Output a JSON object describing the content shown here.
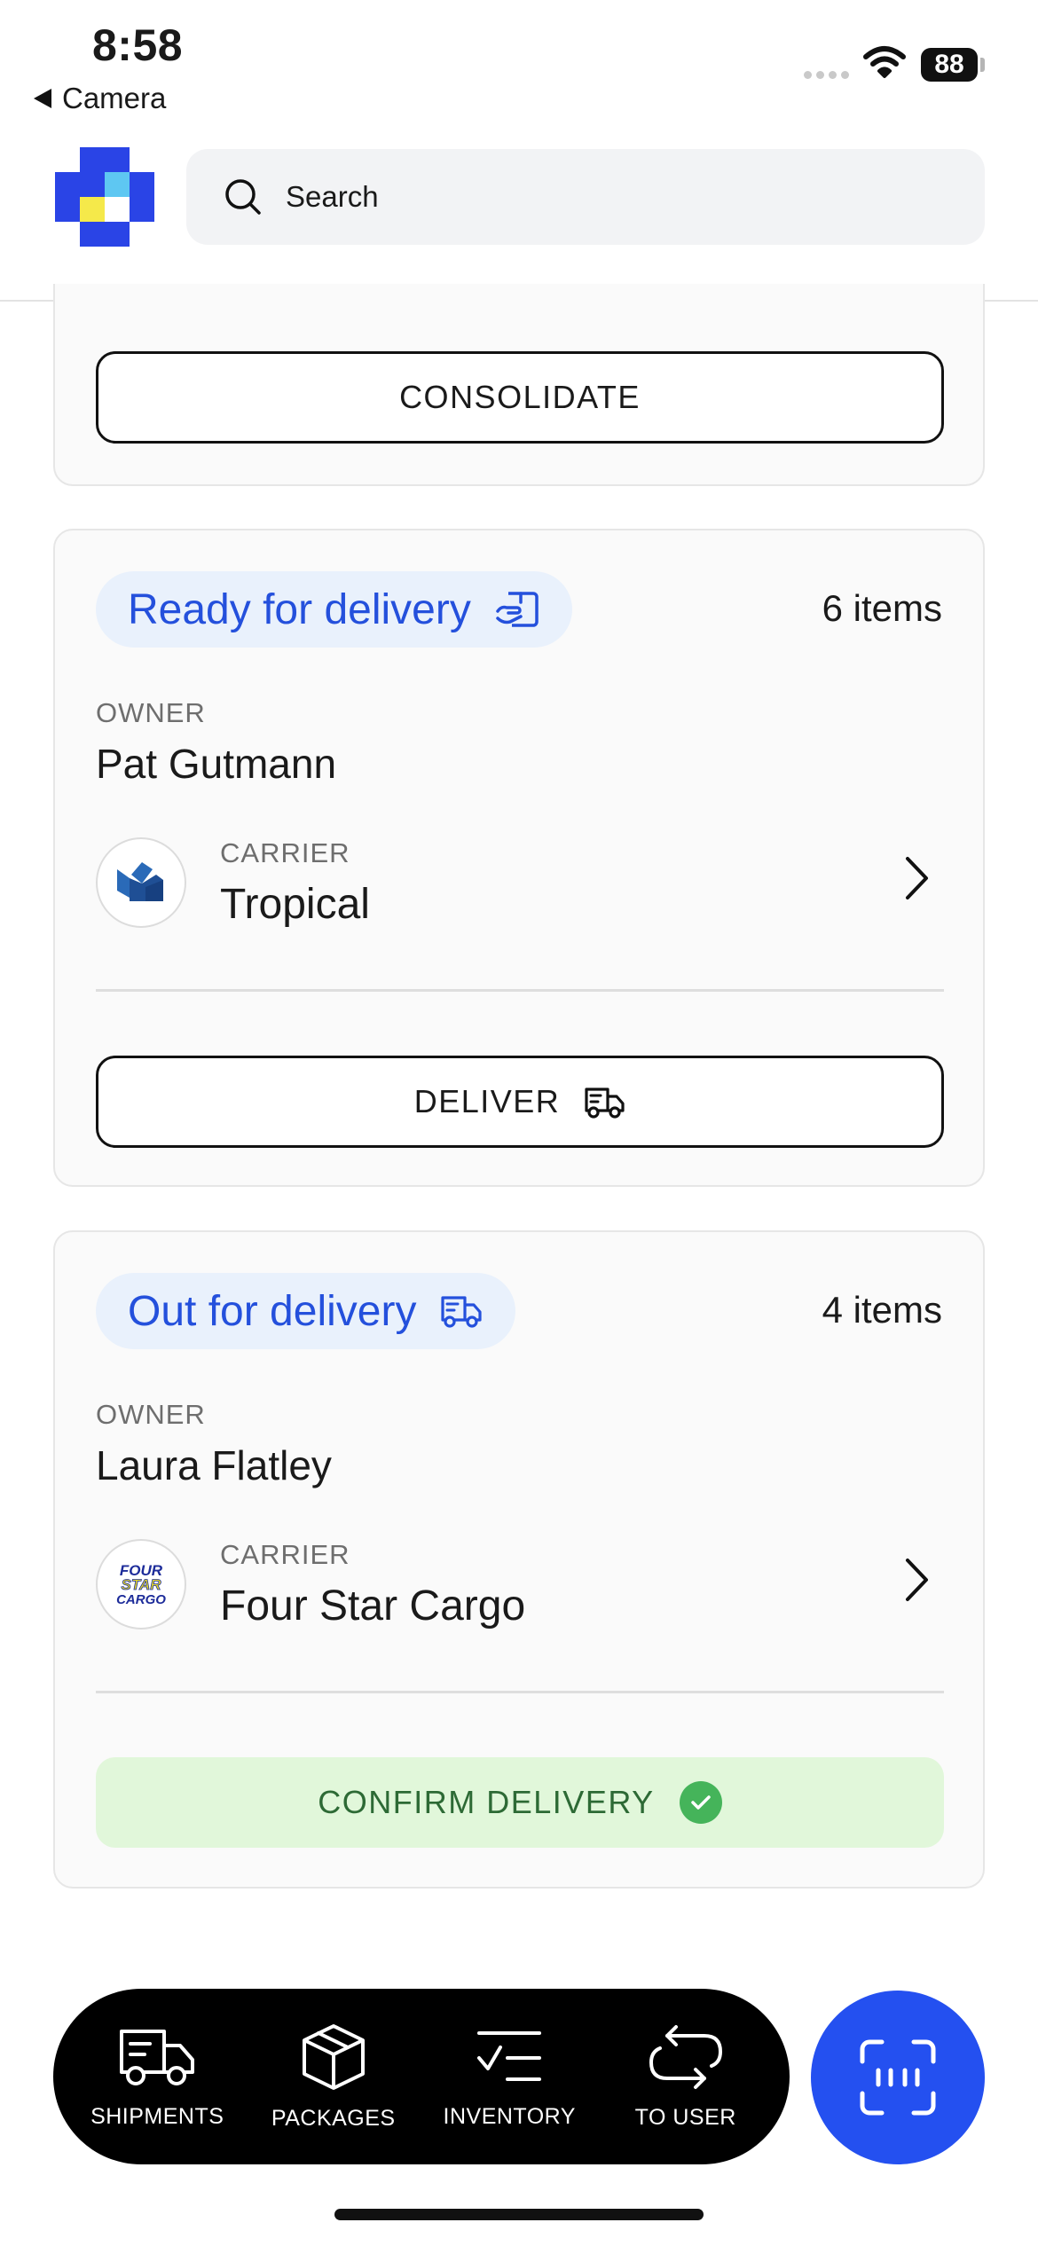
{
  "status_bar": {
    "time": "8:58",
    "back_app": "Camera",
    "battery": "88"
  },
  "header": {
    "search_label": "Search"
  },
  "consolidate_card": {
    "button_label": "CONSOLIDATE"
  },
  "cards": [
    {
      "status": "Ready for delivery",
      "status_icon": "hand-box-icon",
      "items": "6 items",
      "owner_label": "OWNER",
      "owner_name": "Pat Gutmann",
      "carrier_label": "CARRIER",
      "carrier_name": "Tropical",
      "carrier_logo": "tropical-logo",
      "action_label": "DELIVER",
      "action_icon": "truck-icon"
    },
    {
      "status": "Out for delivery",
      "status_icon": "truck-icon",
      "items": "4 items",
      "owner_label": "OWNER",
      "owner_name": "Laura Flatley",
      "carrier_label": "CARRIER",
      "carrier_name": "Four Star Cargo",
      "carrier_logo": "four-star-cargo-logo",
      "carrier_logo_text": [
        "FOUR",
        "STAR",
        "CARGO"
      ],
      "action_label": "CONFIRM DELIVERY",
      "action_icon": "check-circle-icon"
    }
  ],
  "bottom_nav": {
    "items": [
      {
        "label": "SHIPMENTS",
        "icon": "truck-icon"
      },
      {
        "label": "PACKAGES",
        "icon": "box-icon"
      },
      {
        "label": "INVENTORY",
        "icon": "checklist-icon"
      },
      {
        "label": "TO USER",
        "icon": "transfer-icon"
      }
    ],
    "scan_icon": "barcode-scan-icon"
  },
  "colors": {
    "accent": "#2450dc",
    "status_pill_bg": "#e9f1fc",
    "confirm_bg": "#e1f7da",
    "confirm_text": "#2d6a35",
    "confirm_check": "#45b45a",
    "scan_button": "#2450f0"
  }
}
